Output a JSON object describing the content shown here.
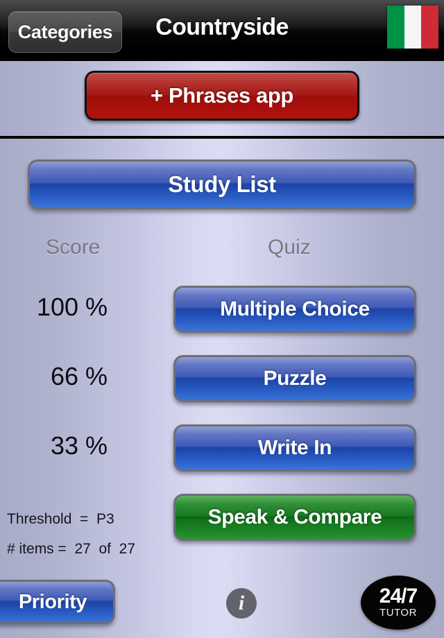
{
  "navbar": {
    "back_label": "Categories",
    "title": "Countryside",
    "flag": {
      "name": "italy-flag",
      "stripes": [
        "#009246",
        "#f5f5f5",
        "#ce2b37"
      ]
    }
  },
  "promo": {
    "label": "+ Phrases app",
    "color": "#a6100d"
  },
  "main": {
    "study_list_label": "Study List",
    "score_column_header": "Score",
    "quiz_column_header": "Quiz",
    "rows": [
      {
        "score": "100 %",
        "quiz_label": "Multiple Choice",
        "color": "#21409f"
      },
      {
        "score": "66 %",
        "quiz_label": "Puzzle",
        "color": "#21409f"
      },
      {
        "score": "33 %",
        "quiz_label": "Write In",
        "color": "#21409f"
      }
    ],
    "extra_quiz": {
      "quiz_label": "Speak & Compare",
      "color": "#0d6417"
    },
    "meta": [
      "Threshold  =  P3",
      "# items =  27  of  27"
    ]
  },
  "footer": {
    "priority_label": "Priority",
    "info_icon_glyph": "i",
    "tutor_badge_top": "24/7",
    "tutor_badge_bottom": "TUTOR"
  }
}
